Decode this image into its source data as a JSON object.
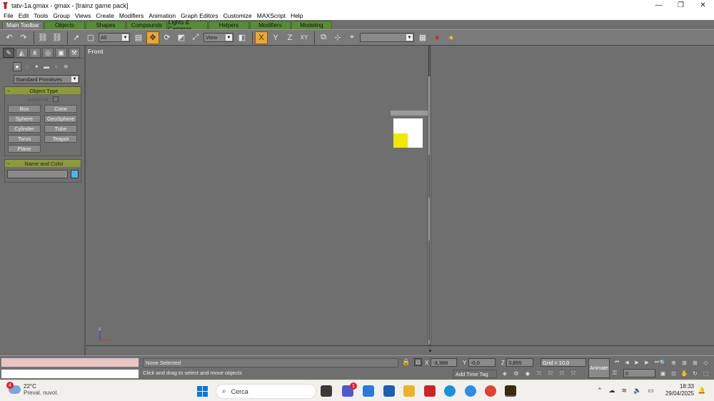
{
  "window": {
    "title": "tatv-1a.gmax - gmax - [trainz game pack]",
    "controls": [
      "—",
      "❐",
      "✕"
    ]
  },
  "menu": [
    "File",
    "Edit",
    "Tools",
    "Group",
    "Views",
    "Create",
    "Modifiers",
    "Animation",
    "Graph Editors",
    "Customize",
    "MAXScript",
    "Help"
  ],
  "tabs": [
    {
      "label": "Main Toolbar",
      "active": true
    },
    {
      "label": "Objects"
    },
    {
      "label": "Shapes"
    },
    {
      "label": "Compounds"
    },
    {
      "label": "Lights & Cameras"
    },
    {
      "label": "Helpers"
    },
    {
      "label": "Modifiers"
    },
    {
      "label": "Modeling"
    }
  ],
  "toolbar": {
    "selection_filter": "All",
    "ref_coord": "View",
    "named_selection": ""
  },
  "command_panel": {
    "primitive_type": "Standard Primitives",
    "object_type_header": "Object Type",
    "autogrid_label": "AutoGrid",
    "primitives": [
      "Box",
      "Cone",
      "Sphere",
      "GeoSphere",
      "Cylinder",
      "Tube",
      "Torus",
      "Teapot",
      "Plane"
    ],
    "name_color_header": "Name and Color",
    "name_value": "",
    "color": "#4fb6e8"
  },
  "viewport": {
    "label": "Front",
    "axis_x": "x",
    "axis_z": "z"
  },
  "status": {
    "selection": "None Selected",
    "prompt": "Click and drag to select and move objects",
    "x_label": "X",
    "x_value": "-3,388",
    "y_label": "Y",
    "y_value": "-0,0",
    "z_label": "Z",
    "z_value": "3,855",
    "grid": "Grid = 10,0",
    "add_time_tag": "Add Time Tag",
    "animate": "Animate",
    "frame": "0"
  },
  "taskbar": {
    "weather_badge": "4",
    "temperature": "22°C",
    "condition": "Preval. nuvol.",
    "search_placeholder": "Cerca",
    "time": "18:33",
    "date": "29/04/2025",
    "teams_badge": "1"
  }
}
